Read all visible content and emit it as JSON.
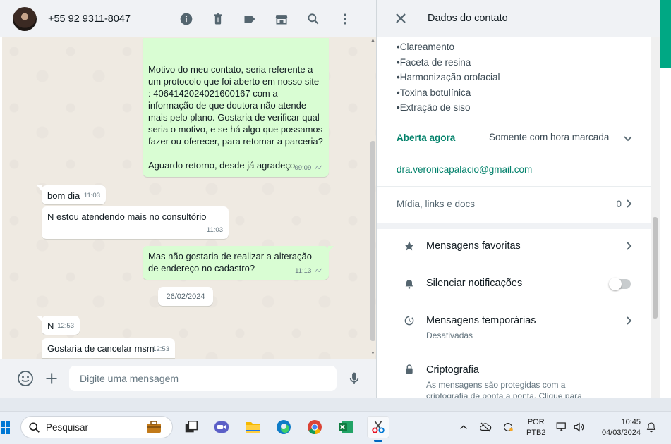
{
  "chat": {
    "contact_name": "+55 92 9311-8047",
    "header_icons": [
      "info-icon",
      "delete-icon",
      "label-icon",
      "store-icon",
      "search-icon",
      "menu-icon"
    ],
    "messages": [
      {
        "text": "Motivo do meu contato, seria referente a um protocolo que foi aberto em nosso site : 4064142024021600167 com a informação de que doutora não atende mais pelo plano. Gostaria de verificar qual seria o motivo, e se há algo que possamos fazer ou oferecer, para retomar a parceria?\n\nAguardo retorno, desde já agradeço.",
        "time": "09:09",
        "direction": "out"
      },
      {
        "text": "bom dia",
        "time": "11:03",
        "direction": "in"
      },
      {
        "text": "N estou atendendo mais no consultório",
        "time": "11:03",
        "direction": "in"
      },
      {
        "text": "Mas não gostaria de realizar a alteração de endereço no cadastro?",
        "time": "11:13",
        "direction": "out"
      },
      {
        "text": "N",
        "time": "12:53",
        "direction": "in"
      },
      {
        "text": "Gostaria de cancelar msm",
        "time": "12:53",
        "direction": "in"
      }
    ],
    "date_chip": "26/02/2024",
    "composer_placeholder": "Digite uma mensagem"
  },
  "contact_info": {
    "title": "Dados do contato",
    "services": [
      "•Clareamento",
      "•Faceta de resina",
      "•Harmonização orofacial",
      "•Toxina botulínica",
      "•Extração de siso"
    ],
    "open_status": "Aberta agora",
    "hours": "Somente com hora marcada",
    "email": "dra.veronicapalacio@gmail.com",
    "media_label": "Mídia, links e docs",
    "media_count": "0",
    "rows": [
      {
        "label": "Mensagens favoritas",
        "icon": "star-icon"
      },
      {
        "label": "Silenciar notificações",
        "icon": "bell-icon"
      },
      {
        "label": "Mensagens temporárias",
        "sub": "Desativadas",
        "icon": "timer-icon"
      },
      {
        "label": "Criptografia",
        "sub": "As mensagens são protegidas com a criptografia de ponta a ponta. Clique para",
        "icon": "lock-icon"
      }
    ]
  },
  "taskbar": {
    "search_placeholder": "Pesquisar",
    "apps": [
      "briefcase-icon",
      "task-view-icon",
      "teams-icon",
      "file-explorer-icon",
      "edge-icon",
      "chrome-icon",
      "excel-icon",
      "snipping-tool-icon"
    ],
    "lang_line1": "POR",
    "lang_line2": "PTB2",
    "time": "10:45",
    "date": "04/03/2024"
  },
  "colors": {
    "accent": "#00a884",
    "bubble_out": "#d9fdd3",
    "panel_bg": "#f0f2f5"
  }
}
